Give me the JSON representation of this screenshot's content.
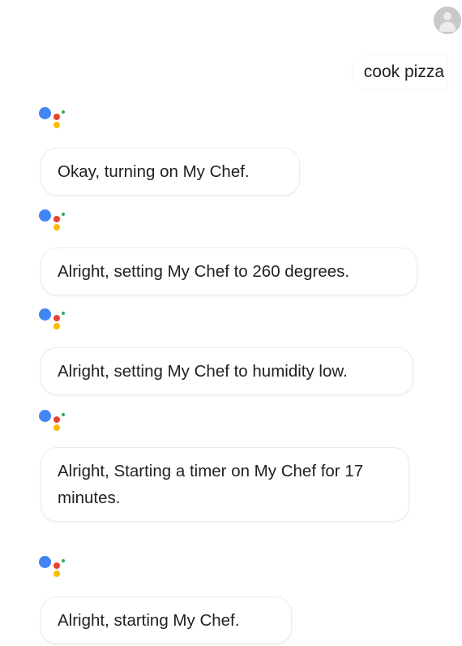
{
  "user": {
    "avatar_icon": "account-icon",
    "message": "cook pizza"
  },
  "assistant": {
    "logo_icon": "google-assistant-icon",
    "logo_colors": [
      "#4285f4",
      "#ea4335",
      "#fbbc05",
      "#34a853"
    ],
    "responses": [
      "Okay, turning on My Chef.",
      "Alright, setting My Chef to 260 degrees.",
      "Alright, setting My Chef to humidity low.",
      "Alright, Starting a timer on My Chef for 17 minutes.",
      "Alright, starting My Chef."
    ]
  }
}
